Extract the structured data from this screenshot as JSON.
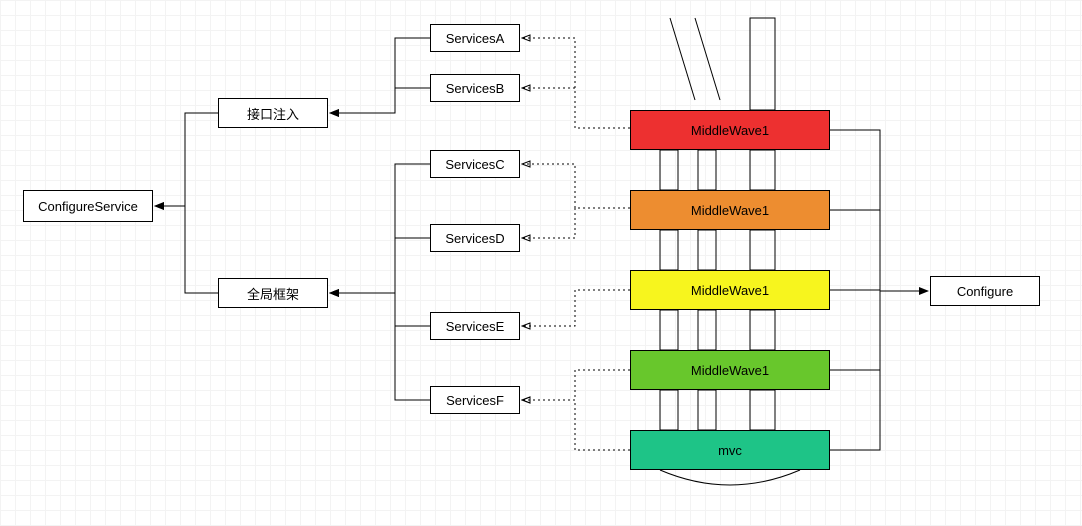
{
  "left": {
    "configureService": "ConfigureService",
    "interfaceInjection": "接口注入",
    "globalFramework": "全局框架"
  },
  "services": {
    "a": "ServicesA",
    "b": "ServicesB",
    "c": "ServicesC",
    "d": "ServicesD",
    "e": "ServicesE",
    "f": "ServicesF"
  },
  "middlewares": {
    "m1": "MiddleWave1",
    "m2": "MiddleWave1",
    "m3": "MiddleWave1",
    "m4": "MiddleWave1",
    "mvc": "mvc"
  },
  "right": {
    "configure": "Configure"
  },
  "colors": {
    "m1": "#ed3030",
    "m2": "#ed8d30",
    "m3": "#f7f51e",
    "m4": "#68c72c",
    "mvc": "#1ec487"
  }
}
